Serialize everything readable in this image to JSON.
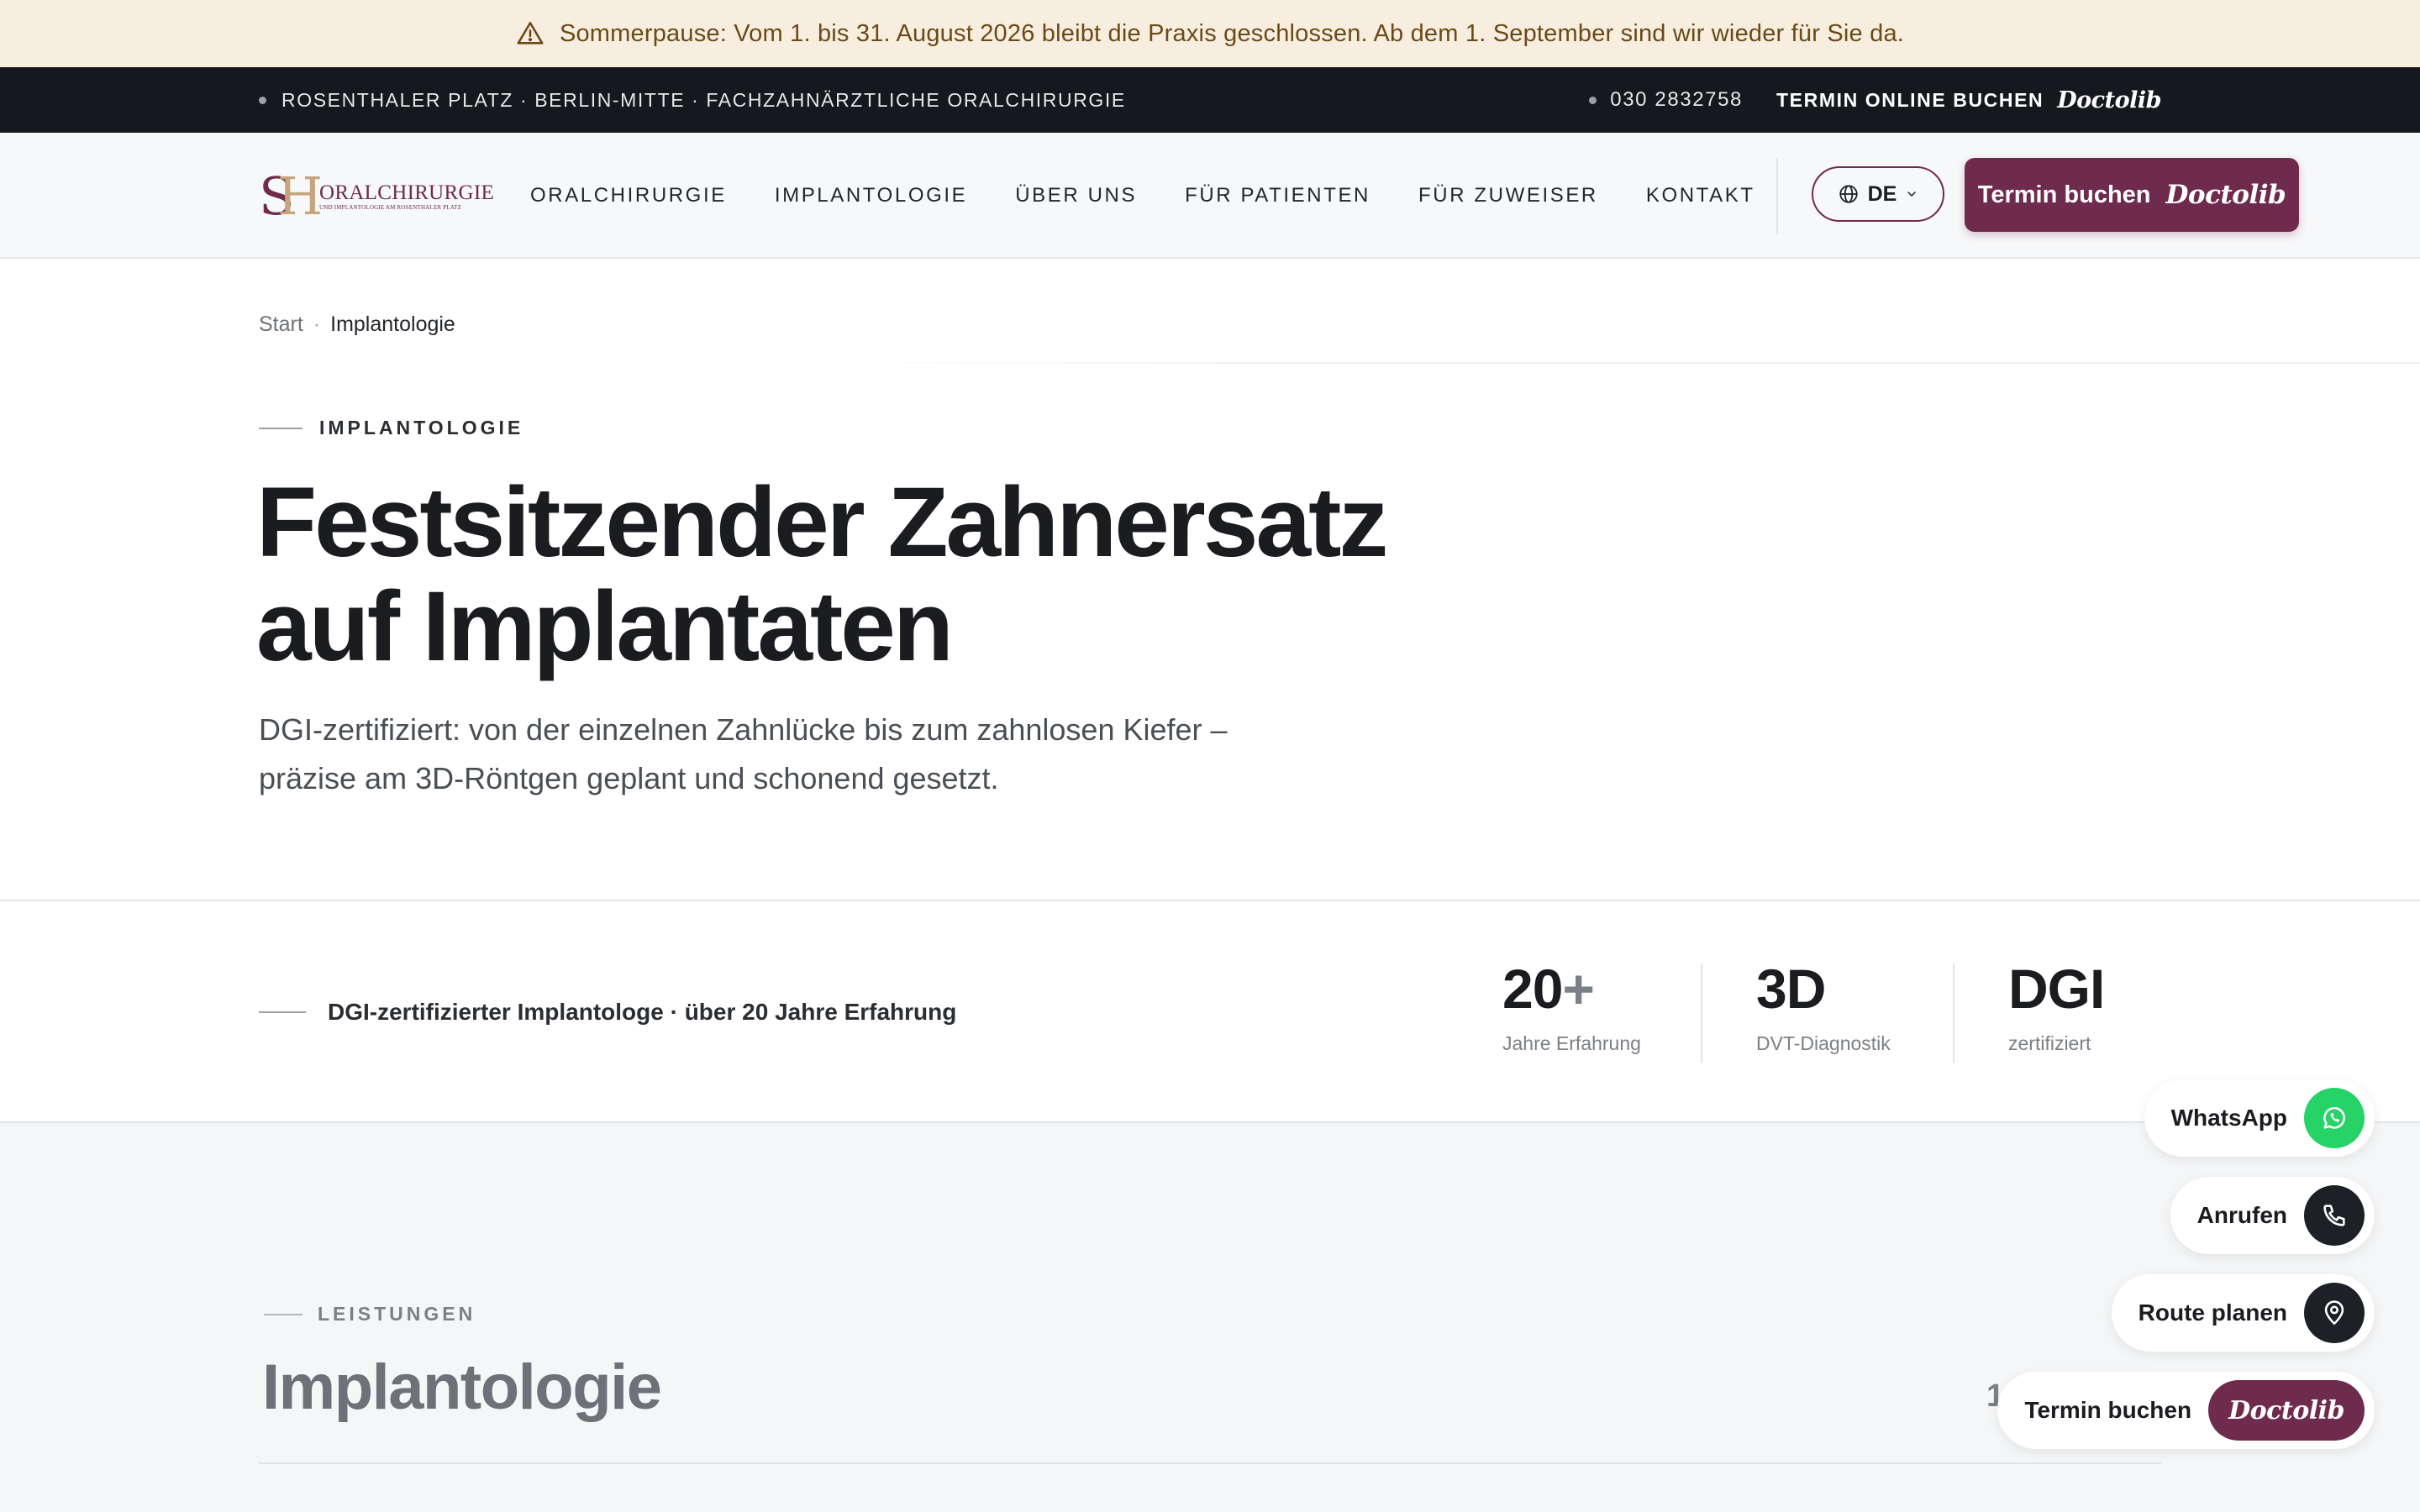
{
  "announcement": {
    "icon": "warning-triangle-icon",
    "text": "Sommerpause: Vom 1. bis 31. August 2026 bleibt die Praxis geschlossen. Ab dem 1. September sind wir wieder für Sie da."
  },
  "infobar": {
    "location": "ROSENTHALER PLATZ · BERLIN-MITTE · FACHZAHNÄRZTLICHE ORALCHIRURGIE",
    "phone": "030 2832758",
    "book_label": "TERMIN ONLINE BUCHEN",
    "doctolib": "Doctolib"
  },
  "nav": {
    "logo_text": "ORALCHIRURGIE",
    "logo_sub": "UND IMPLANTOLOGIE AM ROSENTHALER PLATZ",
    "logo_monogram_s": "S",
    "logo_monogram_h": "H",
    "links": [
      "ORALCHIRURGIE",
      "IMPLANTOLOGIE",
      "ÜBER UNS",
      "FÜR PATIENTEN",
      "FÜR ZUWEISER",
      "KONTAKT"
    ],
    "language": "DE",
    "cta_label": "Termin buchen",
    "cta_doctolib": "Doctolib"
  },
  "hero": {
    "breadcrumb": {
      "start": "Start",
      "separator": "·",
      "current": "Implantologie"
    },
    "eyebrow": "IMPLANTOLOGIE",
    "title_line1": "Festsitzender Zahnersatz",
    "title_line2": "auf Implantaten",
    "subtitle": "DGI-zertifiziert: von der einzelnen Zahnlücke bis zum zahnlosen Kiefer – präzise am 3D-Röntgen geplant und schonend gesetzt."
  },
  "stats": {
    "note": "DGI-zertifizierter Implantologe · über 20 Jahre Erfahrung",
    "items": [
      {
        "value": "20",
        "suffix": "+",
        "label": "Jahre Erfahrung"
      },
      {
        "value": "3D",
        "suffix": "",
        "label": "DVT-Diagnostik"
      },
      {
        "value": "DGI",
        "suffix": "",
        "label": "zertifiziert"
      }
    ]
  },
  "services": {
    "eyebrow": "LEISTUNGEN",
    "title": "Implantologie",
    "count": "16",
    "count_unit": "L"
  },
  "floating": {
    "whatsapp": "WhatsApp",
    "call": "Anrufen",
    "route": "Route planen",
    "book": "Termin buchen",
    "book_doctolib": "Doctolib"
  },
  "colors": {
    "brand": "#6e2b4d",
    "whatsapp": "#25d366",
    "announce_bg": "#f7eee0",
    "dark_bar": "#15181c"
  }
}
